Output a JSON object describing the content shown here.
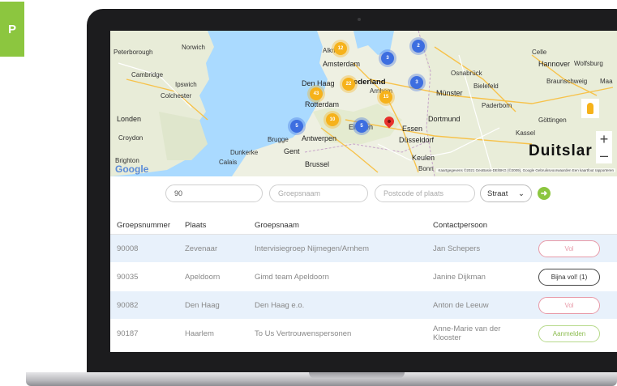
{
  "badge": {
    "letter": "P"
  },
  "map": {
    "labels": {
      "peterborough": "Peterborough",
      "norwich": "Norwich",
      "cambridge": "Cambridge",
      "ipswich": "Ipswich",
      "colchester": "Colchester",
      "london": "Londen",
      "croydon": "Croydon",
      "brighton": "Brighton",
      "alkmaar": "Alkm",
      "amsterdam": "Amsterdam",
      "denhaag": "Den Haag",
      "nederland": "ederland",
      "arnhem": "Arnhem",
      "rotterdam": "Rotterdam",
      "brugge": "Brugge",
      "antwerpen": "Antwerpen",
      "gent": "Gent",
      "brussel": "Brussel",
      "dunkerke": "Dunkerke",
      "calais": "Calais",
      "eindhoven": "Ein  ven",
      "essen": "Essen",
      "dusseldorf": "Düsseldorf",
      "keulen": "Keulen",
      "bonn": "Bonn",
      "dortmund": "Dortmund",
      "munster": "Münster",
      "osnabruck": "Osnabrück",
      "bielefeld": "Bielefeld",
      "paderborn": "Paderborn",
      "hannover": "Hannover",
      "wolfsburg": "Wolfsburg",
      "celle": "Celle",
      "braunschweig": "Braunschweig",
      "maa": "Maa",
      "gottingen": "Göttingen",
      "kassel": "Kassel",
      "duitsland": "Duitslar"
    },
    "clusters": [
      {
        "label": "12",
        "color": "orange"
      },
      {
        "label": "3",
        "color": "blue"
      },
      {
        "label": "2",
        "color": "blue"
      },
      {
        "label": "43",
        "color": "orange"
      },
      {
        "label": "22",
        "color": "orange"
      },
      {
        "label": "15",
        "color": "orange"
      },
      {
        "label": "3",
        "color": "blue"
      },
      {
        "label": "10",
        "color": "orange"
      },
      {
        "label": "5",
        "color": "blue"
      },
      {
        "label": "5",
        "color": "blue"
      }
    ],
    "zoom_in": "+",
    "zoom_out": "–",
    "google": "Google",
    "attribution": "Kaartgegevens ©2021 GeoBasis-DE/BKG (©2009), Google   Gebruiksvoorwaarden   Een kaartfout rapporteren"
  },
  "filters": {
    "group_number_value": "90",
    "group_name_placeholder": "Groepsnaam",
    "postcode_placeholder": "Postcode of plaats",
    "street_select": "Straat",
    "go_symbol": "➜"
  },
  "table": {
    "headers": [
      "Groepsnummer",
      "Plaats",
      "Groepsnaam",
      "Contactpersoon"
    ],
    "rows": [
      {
        "number": "90008",
        "place": "Zevenaar",
        "name": "Intervisiegroep Nijmegen/Arnhem",
        "contact": "Jan Schepers",
        "status": "Vol",
        "status_type": "vol"
      },
      {
        "number": "90035",
        "place": "Apeldoorn",
        "name": "Gimd team Apeldoorn",
        "contact": "Janine Dijkman",
        "status": "Bijna vol! (1)",
        "status_type": "bijna"
      },
      {
        "number": "90082",
        "place": "Den Haag",
        "name": "Den Haag e.o.",
        "contact": "Anton de Leeuw",
        "status": "Vol",
        "status_type": "vol"
      },
      {
        "number": "90187",
        "place": "Haarlem",
        "name": "To Us Vertrouwenspersonen",
        "contact": "Anne-Marie van der Klooster",
        "status": "Aanmelden",
        "status_type": "aan"
      }
    ]
  }
}
